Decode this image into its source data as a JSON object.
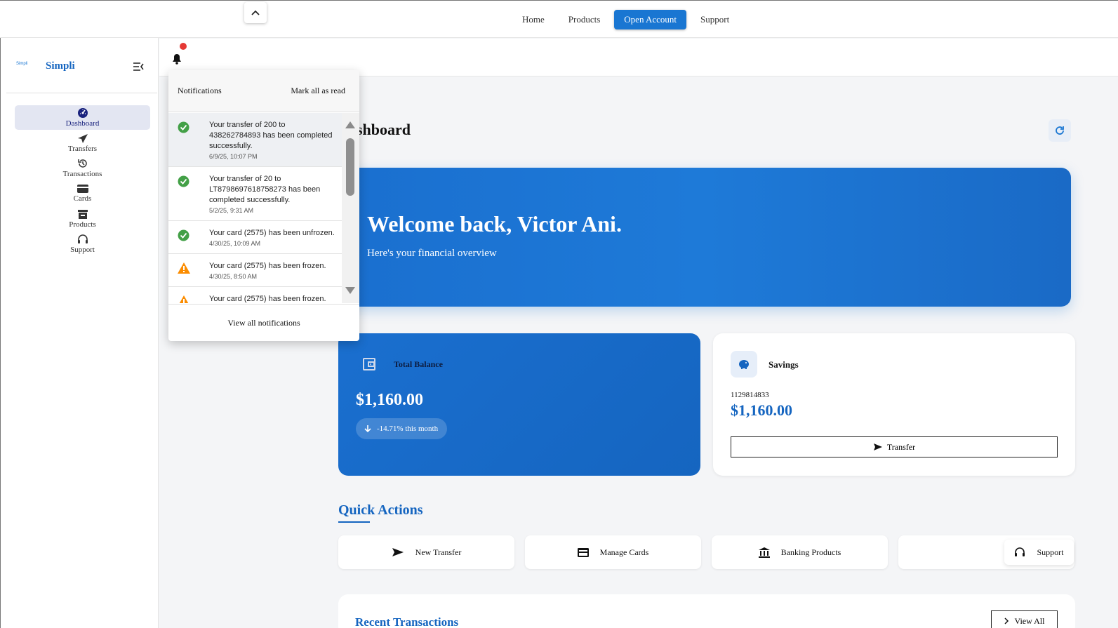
{
  "topnav": {
    "home": "Home",
    "products": "Products",
    "open_account": "Open Account",
    "support": "Support"
  },
  "brand": {
    "logo_text": "Simpli",
    "name": "Simpli"
  },
  "sidebar": {
    "items": [
      {
        "label": "Dashboard",
        "icon": "dashboard-icon",
        "active": true
      },
      {
        "label": "Transfers",
        "icon": "send-icon"
      },
      {
        "label": "Transactions",
        "icon": "history-icon"
      },
      {
        "label": "Cards",
        "icon": "card-icon"
      },
      {
        "label": "Products",
        "icon": "store-icon"
      },
      {
        "label": "Support",
        "icon": "headset-icon"
      }
    ]
  },
  "page": {
    "title_visible": "shboard"
  },
  "hero": {
    "title": "Welcome back, Victor Ani.",
    "subtitle": "Here's your financial overview"
  },
  "balance": {
    "label": "Total Balance",
    "amount": "$1,160.00",
    "change": "-14.71% this month"
  },
  "savings": {
    "title": "Savings",
    "account": "1129814833",
    "amount": "$1,160.00",
    "transfer_label": "Transfer"
  },
  "quick_actions": {
    "title": "Quick Actions",
    "items": [
      {
        "label": "New Transfer",
        "icon": "send-icon"
      },
      {
        "label": "Manage Cards",
        "icon": "card-icon"
      },
      {
        "label": "Banking Products",
        "icon": "bank-icon"
      },
      {
        "label": "Support",
        "icon": "headset-icon"
      }
    ]
  },
  "recent": {
    "title": "Recent Transactions",
    "view_all": "View All"
  },
  "notifications": {
    "title": "Notifications",
    "mark_all": "Mark all as read",
    "footer": "View all notifications",
    "items": [
      {
        "message": "Your transfer of 200 to 438262784893 has been completed successfully.",
        "time": "6/9/25, 10:07 PM",
        "type": "success"
      },
      {
        "message": "Your transfer of 20 to LT8798697618758273 has been completed successfully.",
        "time": "5/2/25, 9:31 AM",
        "type": "success"
      },
      {
        "message": "Your card (2575) has been unfrozen.",
        "time": "4/30/25, 10:09 AM",
        "type": "success"
      },
      {
        "message": "Your card (2575) has been frozen.",
        "time": "4/30/25, 8:50 AM",
        "type": "warning"
      },
      {
        "message": "Your card (2575) has been frozen.",
        "time": "",
        "type": "warning"
      }
    ]
  },
  "colors": {
    "primary": "#1976d2",
    "success": "#43a047",
    "warning": "#fb8c00",
    "alert_dot": "#e53935"
  }
}
